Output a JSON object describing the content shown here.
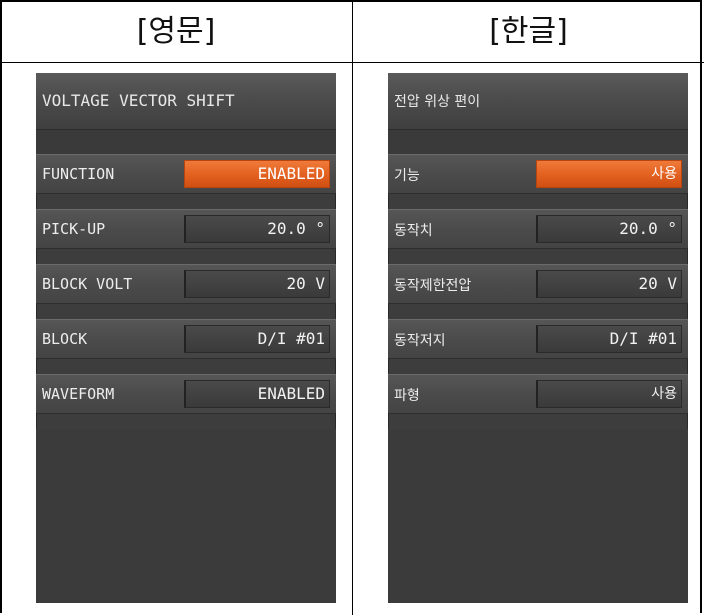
{
  "columns": [
    {
      "header": "[영문]",
      "title": "VOLTAGE VECTOR SHIFT",
      "rows": [
        {
          "label": "FUNCTION",
          "value": "ENABLED"
        },
        {
          "label": "PICK-UP",
          "value": "20.0 °"
        },
        {
          "label": "BLOCK VOLT",
          "value": "20 V"
        },
        {
          "label": "BLOCK",
          "value": "D/I #01"
        },
        {
          "label": "WAVEFORM",
          "value": "ENABLED"
        }
      ]
    },
    {
      "header": "[한글]",
      "title": "전압 위상 편이",
      "rows": [
        {
          "label": "기능",
          "value": "사용"
        },
        {
          "label": "동작치",
          "value": "20.0 °"
        },
        {
          "label": "동작제한전압",
          "value": "20 V"
        },
        {
          "label": "동작저지",
          "value": "D/I #01"
        },
        {
          "label": "파형",
          "value": "사용"
        }
      ]
    }
  ],
  "colors": {
    "active_value": "#e2601f",
    "panel_background": "#3d3d3d",
    "text": "#ededed"
  }
}
